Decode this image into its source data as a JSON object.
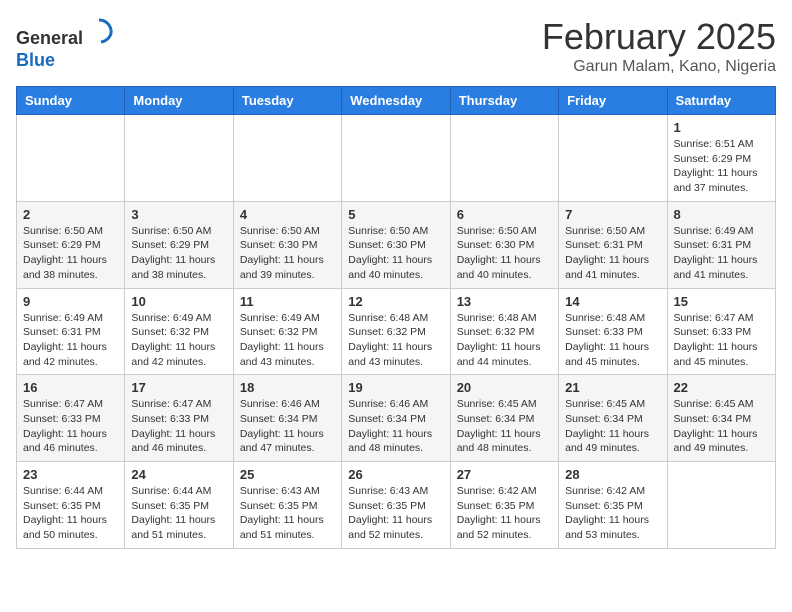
{
  "header": {
    "logo_line1": "General",
    "logo_line2": "Blue",
    "month_title": "February 2025",
    "location": "Garun Malam, Kano, Nigeria"
  },
  "days_of_week": [
    "Sunday",
    "Monday",
    "Tuesday",
    "Wednesday",
    "Thursday",
    "Friday",
    "Saturday"
  ],
  "weeks": [
    [
      {
        "day": "",
        "info": ""
      },
      {
        "day": "",
        "info": ""
      },
      {
        "day": "",
        "info": ""
      },
      {
        "day": "",
        "info": ""
      },
      {
        "day": "",
        "info": ""
      },
      {
        "day": "",
        "info": ""
      },
      {
        "day": "1",
        "info": "Sunrise: 6:51 AM\nSunset: 6:29 PM\nDaylight: 11 hours and 37 minutes."
      }
    ],
    [
      {
        "day": "2",
        "info": "Sunrise: 6:50 AM\nSunset: 6:29 PM\nDaylight: 11 hours and 38 minutes."
      },
      {
        "day": "3",
        "info": "Sunrise: 6:50 AM\nSunset: 6:29 PM\nDaylight: 11 hours and 38 minutes."
      },
      {
        "day": "4",
        "info": "Sunrise: 6:50 AM\nSunset: 6:30 PM\nDaylight: 11 hours and 39 minutes."
      },
      {
        "day": "5",
        "info": "Sunrise: 6:50 AM\nSunset: 6:30 PM\nDaylight: 11 hours and 40 minutes."
      },
      {
        "day": "6",
        "info": "Sunrise: 6:50 AM\nSunset: 6:30 PM\nDaylight: 11 hours and 40 minutes."
      },
      {
        "day": "7",
        "info": "Sunrise: 6:50 AM\nSunset: 6:31 PM\nDaylight: 11 hours and 41 minutes."
      },
      {
        "day": "8",
        "info": "Sunrise: 6:49 AM\nSunset: 6:31 PM\nDaylight: 11 hours and 41 minutes."
      }
    ],
    [
      {
        "day": "9",
        "info": "Sunrise: 6:49 AM\nSunset: 6:31 PM\nDaylight: 11 hours and 42 minutes."
      },
      {
        "day": "10",
        "info": "Sunrise: 6:49 AM\nSunset: 6:32 PM\nDaylight: 11 hours and 42 minutes."
      },
      {
        "day": "11",
        "info": "Sunrise: 6:49 AM\nSunset: 6:32 PM\nDaylight: 11 hours and 43 minutes."
      },
      {
        "day": "12",
        "info": "Sunrise: 6:48 AM\nSunset: 6:32 PM\nDaylight: 11 hours and 43 minutes."
      },
      {
        "day": "13",
        "info": "Sunrise: 6:48 AM\nSunset: 6:32 PM\nDaylight: 11 hours and 44 minutes."
      },
      {
        "day": "14",
        "info": "Sunrise: 6:48 AM\nSunset: 6:33 PM\nDaylight: 11 hours and 45 minutes."
      },
      {
        "day": "15",
        "info": "Sunrise: 6:47 AM\nSunset: 6:33 PM\nDaylight: 11 hours and 45 minutes."
      }
    ],
    [
      {
        "day": "16",
        "info": "Sunrise: 6:47 AM\nSunset: 6:33 PM\nDaylight: 11 hours and 46 minutes."
      },
      {
        "day": "17",
        "info": "Sunrise: 6:47 AM\nSunset: 6:33 PM\nDaylight: 11 hours and 46 minutes."
      },
      {
        "day": "18",
        "info": "Sunrise: 6:46 AM\nSunset: 6:34 PM\nDaylight: 11 hours and 47 minutes."
      },
      {
        "day": "19",
        "info": "Sunrise: 6:46 AM\nSunset: 6:34 PM\nDaylight: 11 hours and 48 minutes."
      },
      {
        "day": "20",
        "info": "Sunrise: 6:45 AM\nSunset: 6:34 PM\nDaylight: 11 hours and 48 minutes."
      },
      {
        "day": "21",
        "info": "Sunrise: 6:45 AM\nSunset: 6:34 PM\nDaylight: 11 hours and 49 minutes."
      },
      {
        "day": "22",
        "info": "Sunrise: 6:45 AM\nSunset: 6:34 PM\nDaylight: 11 hours and 49 minutes."
      }
    ],
    [
      {
        "day": "23",
        "info": "Sunrise: 6:44 AM\nSunset: 6:35 PM\nDaylight: 11 hours and 50 minutes."
      },
      {
        "day": "24",
        "info": "Sunrise: 6:44 AM\nSunset: 6:35 PM\nDaylight: 11 hours and 51 minutes."
      },
      {
        "day": "25",
        "info": "Sunrise: 6:43 AM\nSunset: 6:35 PM\nDaylight: 11 hours and 51 minutes."
      },
      {
        "day": "26",
        "info": "Sunrise: 6:43 AM\nSunset: 6:35 PM\nDaylight: 11 hours and 52 minutes."
      },
      {
        "day": "27",
        "info": "Sunrise: 6:42 AM\nSunset: 6:35 PM\nDaylight: 11 hours and 52 minutes."
      },
      {
        "day": "28",
        "info": "Sunrise: 6:42 AM\nSunset: 6:35 PM\nDaylight: 11 hours and 53 minutes."
      },
      {
        "day": "",
        "info": ""
      }
    ]
  ]
}
